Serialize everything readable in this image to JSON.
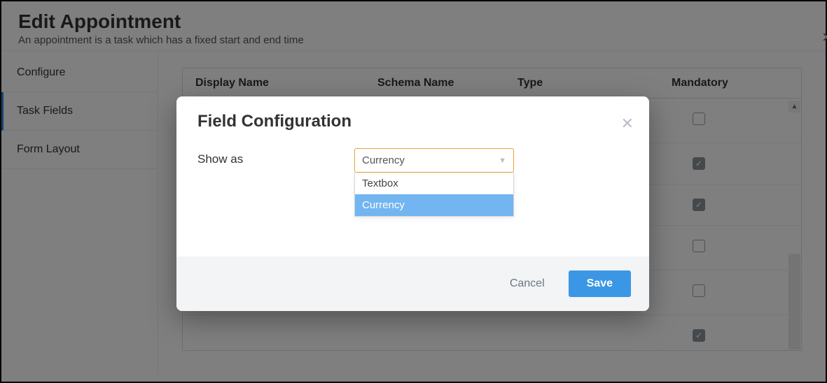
{
  "page": {
    "title": "Edit Appointment",
    "subtitle": "An appointment is a task which has a fixed start and end time",
    "close_glyph": "›"
  },
  "sidebar": {
    "items": [
      {
        "label": "Configure"
      },
      {
        "label": "Task Fields"
      },
      {
        "label": "Form Layout"
      }
    ]
  },
  "table": {
    "headers": {
      "display_name": "Display Name",
      "schema_name": "Schema Name",
      "type": "Type",
      "mandatory": "Mandatory"
    },
    "rows": [
      {
        "mandatory": false
      },
      {
        "mandatory": true
      },
      {
        "mandatory": true
      },
      {
        "mandatory": false
      },
      {
        "mandatory": false
      },
      {
        "mandatory": true
      }
    ]
  },
  "modal": {
    "title": "Field Configuration",
    "close_glyph": "✕",
    "field_label": "Show as",
    "select": {
      "value": "Currency",
      "options": [
        "Textbox",
        "Currency"
      ],
      "selected_index": 1
    },
    "cancel": "Cancel",
    "save": "Save"
  }
}
